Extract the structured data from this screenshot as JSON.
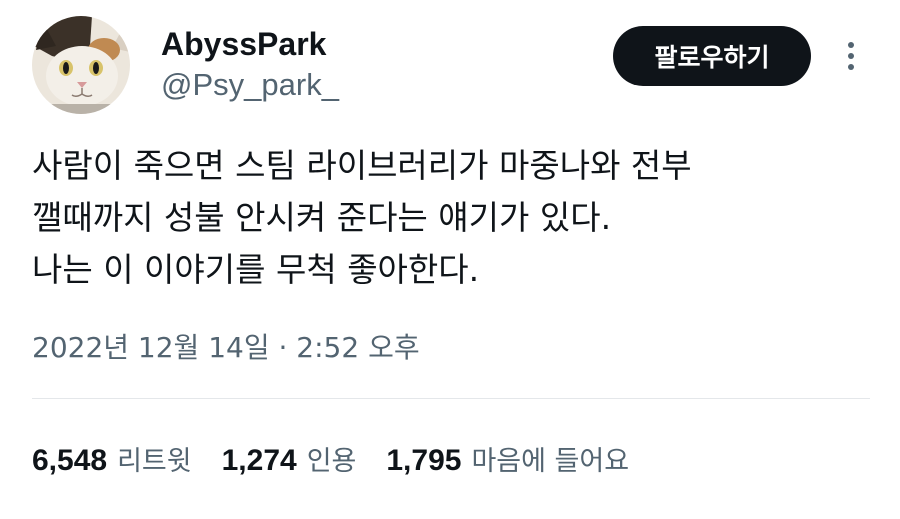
{
  "user": {
    "display_name": "AbyssPark",
    "handle": "@Psy_park_",
    "avatar_icon": "cat-avatar-icon"
  },
  "follow_button": {
    "label": "팔로우하기"
  },
  "more_icon": "more-vertical-icon",
  "tweet": {
    "lines": [
      "사람이 죽으면 스팀 라이브러리가 마중나와 전부",
      "깰때까지 성불 안시켜 준다는 얘기가 있다.",
      "나는 이 이야기를 무척 좋아한다."
    ],
    "timestamp": "2022년 12월 14일 · 2:52 오후"
  },
  "stats": [
    {
      "count": "6,548",
      "label": "리트윗"
    },
    {
      "count": "1,274",
      "label": "인용"
    },
    {
      "count": "1,795",
      "label": "마음에 들어요"
    }
  ],
  "colors": {
    "text_primary": "#0f1419",
    "text_secondary": "#536471",
    "button_bg": "#0f1419",
    "divider": "#e4e7ea"
  }
}
